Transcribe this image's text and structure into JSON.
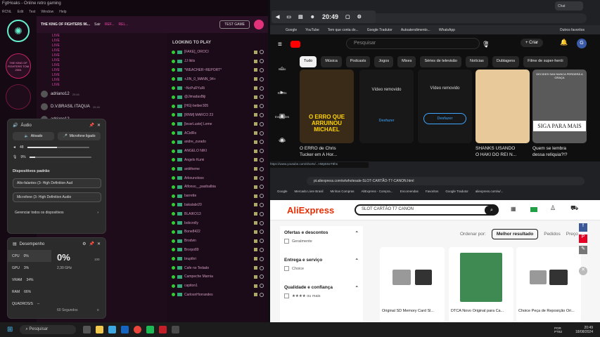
{
  "left": {
    "title": "FgtHoaks - Online retro gaming",
    "menu": [
      "RCNL",
      "Edit",
      "Test",
      "Window",
      "Help"
    ],
    "room_title": "THE KING OF FIGHTERS 96...",
    "top_tabs": [
      "Sair",
      "REF...",
      "REL..."
    ],
    "test_game": "TEST GAME",
    "badge1": "THE KING OF FIGHTERS TOM 2004",
    "chat_lines": [
      "LIVE",
      "LIVE",
      "LIVE",
      "LIVE",
      "LIVE",
      "LIVE",
      "LIVE",
      "LIVE",
      "LIVE",
      "LIVE",
      "LIVE"
    ],
    "msgs": [
      {
        "user": "adriano12",
        "time": "20:46"
      },
      {
        "user": "D.V.BRASIL ITAQUA",
        "time": "20:46"
      },
      {
        "user": "adriano12",
        "time": "20:48"
      }
    ],
    "players_header": "LOOKING TO PLAY",
    "players": [
      "[FAKE]_OROCI",
      "JJ Ikits",
      "*WEACHER~REPORT*",
      "+JIN_0_MANN_94+",
      "~NcPuRYuRi",
      "@JimadasBiji",
      "[HG]-beiber305",
      "[RNM] MARCO 23",
      "[lessrLuste] Leme",
      "ACidRo",
      "andre_zurado",
      "ANGELO NIKI",
      "Angelo Kumi",
      "antitheme",
      "Arkounoloso",
      "Alfonso__pasibalbia",
      "barrette",
      "bakalabr20",
      "BLAIKO13",
      "bobcrolly",
      "Bone8422",
      "Brodvin",
      "Brorpo89",
      "brupthri",
      "Cafe no Tedado",
      "Campeche Marnia",
      "capiton1",
      "CarlosnHorrandes"
    ]
  },
  "audio": {
    "title": "Áudio",
    "btn_enabled": "Ativado",
    "btn_mic": "Microfone ligado",
    "vol_label": "48",
    "vol_value": 48,
    "mic_label": "9%",
    "mic_value": 9,
    "devices_title": "Dispositivos padrão",
    "speakers": "Alto-falantes (3- High Definition Aud",
    "mic_device": "Microfone (3- High Definition Audio",
    "manage": "Gerenciar todos os dispositivos"
  },
  "perf": {
    "title": "Desempenho",
    "big_pct": "0%",
    "freq": "2,30 GHz",
    "right_max": "100",
    "rows": [
      {
        "k": "CPU",
        "v": "0%"
      },
      {
        "k": "GPU",
        "v": "3%"
      },
      {
        "k": "VRAM",
        "v": "34%"
      },
      {
        "k": "RAM",
        "v": "66%"
      },
      {
        "k": "QUADROS/S",
        "v": "--"
      }
    ],
    "seconds": "60 Segundos",
    "zero": "0"
  },
  "overlay": {
    "time": "20:49"
  },
  "yt": {
    "tab_title": "Chat",
    "bookmarks": [
      "Google",
      "YouTube",
      "Tem que conta do...",
      "Google Tradutor",
      "Autoatendimento...",
      "WhatsApp",
      "Outros favoritos"
    ],
    "search_placeholder": "Pesquisar",
    "create": "Criar",
    "avatar": "G",
    "chips": [
      "Tudo",
      "Música",
      "Podcasts",
      "Jogos",
      "Mixes",
      "Séries de televisão",
      "Notícias",
      "Dublagens",
      "Filme de super-herói"
    ],
    "side": [
      "Início",
      "Shorts",
      "Inscrições",
      "Você"
    ],
    "videos": [
      {
        "thumb": "O ERRO QUE ARRUINOU MICHAEL",
        "title1": "O ERRO de Chris",
        "title2": "Tucker em A Hor..."
      },
      {
        "thumb": "Vídeo removido",
        "action": "Desfazer"
      },
      {
        "thumb": "Vídeo removido",
        "action": "Desfazer"
      },
      {
        "thumb": "",
        "title1": "SHANKS USANDO",
        "title2": "O HAKI DO REI N..."
      },
      {
        "thumb": "SIGA PARA MAIS",
        "caption": "DECIDES SAN NUNCA PERDERÁ A GRAÇA",
        "title1": "Quem se lembra",
        "title2": "dessa relíquia?!?"
      }
    ],
    "status_url": "https://www.youtube.com/shorts/...HMp5SeT8hs"
  },
  "ali": {
    "url": "pt.aliexpress.com/w/wholesale-SLOT-CARTÃO-T7-CANON.html",
    "bookmarks": [
      "Google",
      "Mercado Livre Brasil",
      "Minhas Compras",
      "AliExpress - Compra...",
      "Encomendas",
      "Favoritos",
      "Google Tradutor",
      "aliexpress.com/w/..."
    ],
    "logo": "AliExpress",
    "search": "SLOT CARTÃO T7 CANON",
    "sort_label": "Ordenar por:",
    "sort_active": "Melhor resultado",
    "sort_opts": [
      "Pedidos",
      "Preço"
    ],
    "filters": [
      {
        "title": "Ofertas e descontos",
        "opt": "Geralmente"
      },
      {
        "title": "Entrega e serviço",
        "opt": "Choice"
      },
      {
        "title": "Qualidade e confiança",
        "opt": "★★★★ ou mais"
      }
    ],
    "products": [
      "Original SD Memory Card Sl...",
      "DTCA Novo Original para Ca...",
      "Choice Peça de Reposição Ori..."
    ]
  },
  "taskbar": {
    "search": "Pesquisar",
    "lang": "POR PTB2",
    "time": "20:49",
    "date": "18/08/2024"
  }
}
